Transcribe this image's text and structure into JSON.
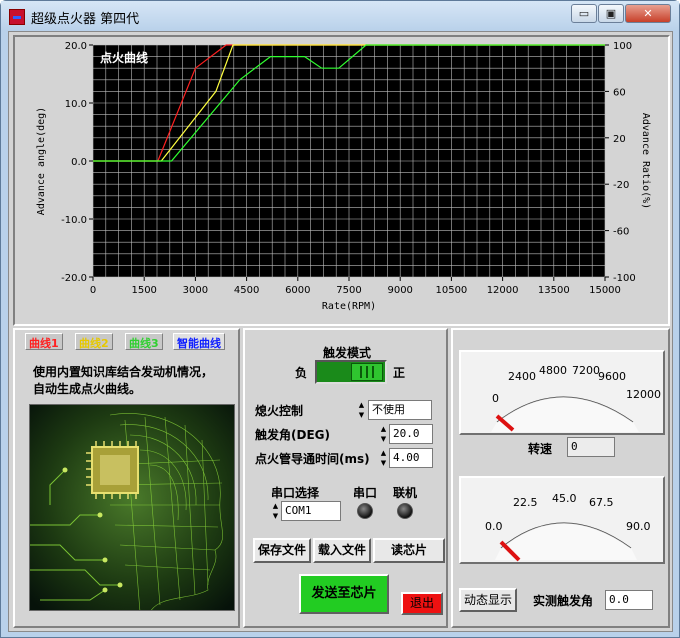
{
  "window": {
    "title": "超级点火器 第四代",
    "minimize_glyph": "▭",
    "maximize_glyph": "▣",
    "close_glyph": "✕"
  },
  "chart_data": {
    "type": "line",
    "title": "点火曲线",
    "xlabel": "Rate(RPM)",
    "ylabel_left": "Advance angle(deg)",
    "ylabel_right": "Advance Ratio(%)",
    "xlim": [
      0,
      15000
    ],
    "ylim_left": [
      -20,
      20
    ],
    "ylim_right": [
      -100,
      100
    ],
    "x_ticks": [
      "0",
      "1500",
      "3000",
      "4500",
      "6000",
      "7500",
      "9000",
      "10500",
      "12000",
      "13500",
      "15000"
    ],
    "y_ticks_left": [
      "20.0",
      "10.0",
      "0.0",
      "-10.0",
      "-20.0"
    ],
    "y_ticks_right": [
      "100",
      "60",
      "20",
      "-20",
      "-60",
      "-100"
    ],
    "background": "#000000",
    "grid": true,
    "series": [
      {
        "name": "曲线1",
        "color": "#ff2020",
        "x": [
          0,
          1900,
          3000,
          3900,
          15000
        ],
        "y": [
          0,
          0,
          16,
          20,
          20
        ]
      },
      {
        "name": "曲线2",
        "color": "#ffff40",
        "x": [
          0,
          2000,
          3600,
          4100,
          15000
        ],
        "y": [
          0,
          0,
          12,
          20,
          20
        ]
      },
      {
        "name": "曲线3",
        "color": "#30ff30",
        "x": [
          0,
          2300,
          4300,
          5200,
          6200,
          6700,
          7200,
          8000,
          15000
        ],
        "y": [
          0,
          0,
          14,
          18,
          18,
          16,
          16,
          20,
          20
        ]
      }
    ]
  },
  "tabs": [
    {
      "label": "曲线1",
      "color": "#ff2020"
    },
    {
      "label": "曲线2",
      "color": "#e6c800"
    },
    {
      "label": "曲线3",
      "color": "#30d030"
    },
    {
      "label": "智能曲线",
      "color": "#1020ff"
    }
  ],
  "left": {
    "desc_line1": "使用内置知识库结合发动机情况，",
    "desc_line2": "自动生成点火曲线。"
  },
  "mid": {
    "trigger_mode_label": "触发模式",
    "neg_label": "负",
    "pos_label": "正",
    "quench_label": "熄火控制",
    "quench_value": "不使用",
    "trigger_angle_label": "触发角(DEG)",
    "trigger_angle_value": "20.0",
    "conduct_label": "点火管导通时间(ms)",
    "conduct_value": "4.00",
    "port_select_label": "串口选择",
    "port_value": "COM1",
    "serial_label": "串口",
    "online_label": "联机",
    "save_file": "保存文件",
    "load_file": "载入文件",
    "read_chip": "读芯片",
    "send_chip": "发送至芯片",
    "exit": "退出",
    "toggle_on_color": "#2fc42f"
  },
  "right": {
    "rpm_ticks": [
      "0",
      "2400",
      "4800",
      "7200",
      "9600",
      "12000"
    ],
    "rpm_label": "转速",
    "rpm_value": "0",
    "rpm_needle_fraction": 0,
    "angle_ticks": [
      "0.0",
      "22.5",
      "45.0",
      "67.5",
      "90.0"
    ],
    "dynamic_btn": "动态显示",
    "angle_label": "实测触发角",
    "angle_value": "0.0",
    "angle_needle_fraction": 0,
    "needle_color": "#dd1111"
  }
}
